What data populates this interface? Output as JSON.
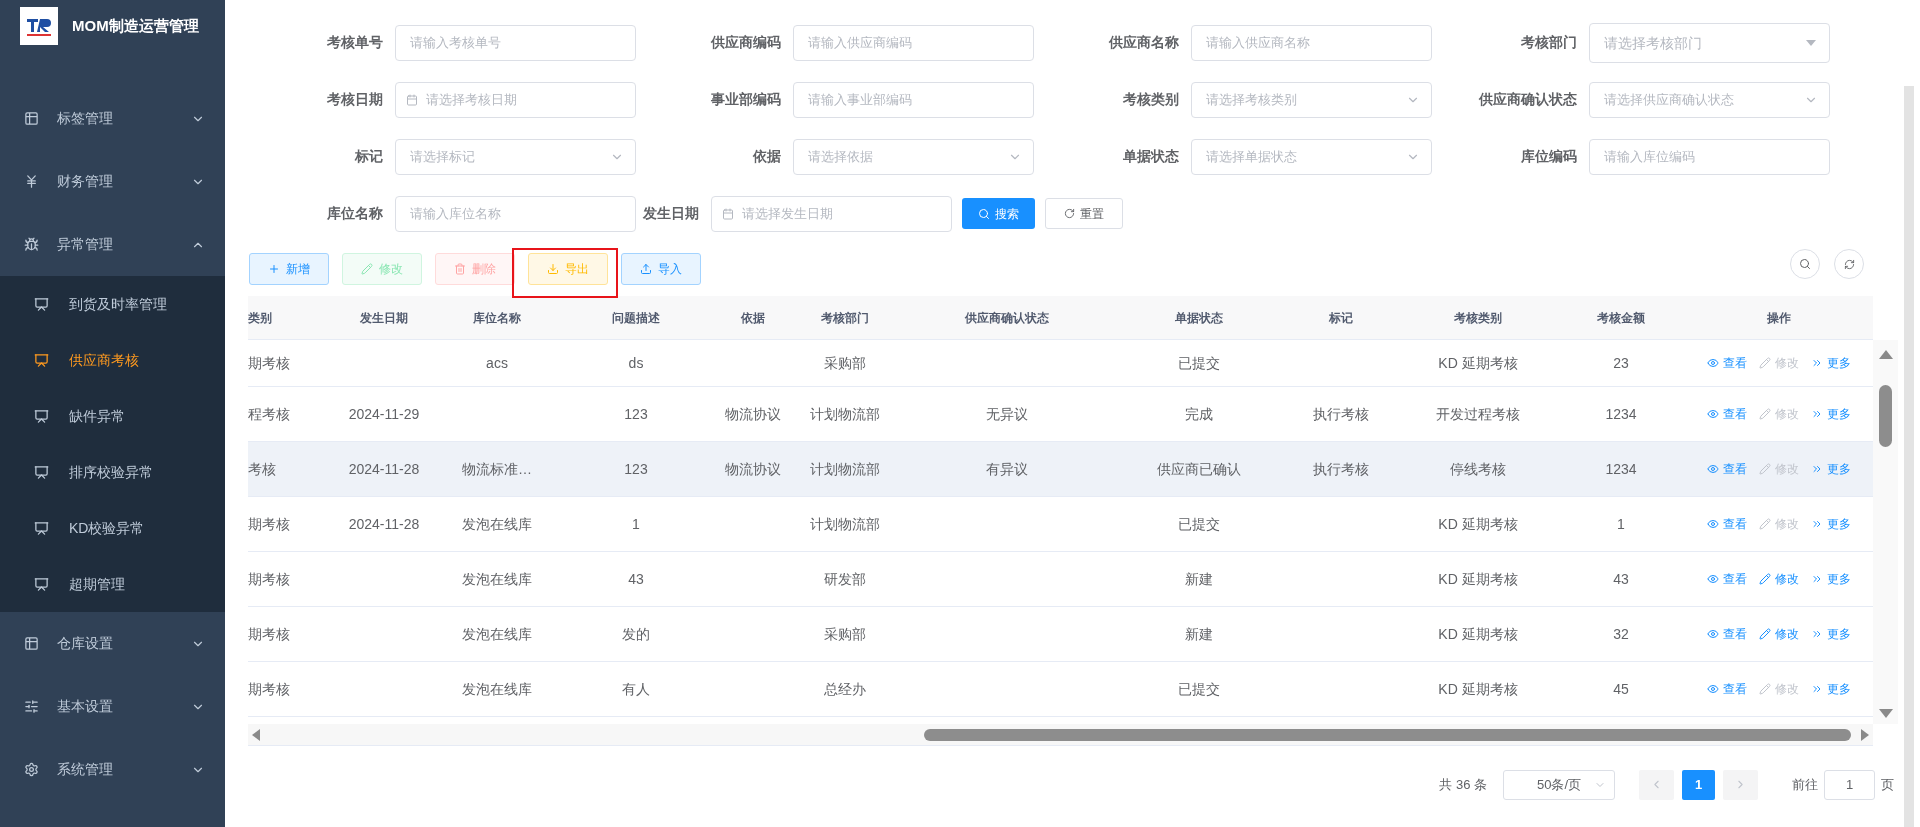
{
  "sidebar": {
    "title": "MOM制造运营管理",
    "items": [
      {
        "label": "标签管理",
        "kind": "grid",
        "expanded": false
      },
      {
        "label": "财务管理",
        "kind": "yen",
        "expanded": false
      },
      {
        "label": "异常管理",
        "kind": "bug",
        "expanded": true,
        "children": [
          {
            "label": "到货及时率管理",
            "selected": false
          },
          {
            "label": "供应商考核",
            "selected": true
          },
          {
            "label": "缺件异常",
            "selected": false
          },
          {
            "label": "排序校验异常",
            "selected": false
          },
          {
            "label": "KD校验异常",
            "selected": false
          },
          {
            "label": "超期管理",
            "selected": false
          }
        ]
      },
      {
        "label": "仓库设置",
        "kind": "grid",
        "expanded": false
      },
      {
        "label": "基本设置",
        "kind": "sliders",
        "expanded": false
      },
      {
        "label": "系统管理",
        "kind": "gear",
        "expanded": false
      }
    ]
  },
  "filters": [
    {
      "label": "考核单号",
      "kind": "text",
      "placeholder": "请输入考核单号"
    },
    {
      "label": "供应商编码",
      "kind": "text",
      "placeholder": "请输入供应商编码"
    },
    {
      "label": "供应商名称",
      "kind": "text",
      "placeholder": "请输入供应商名称"
    },
    {
      "label": "考核部门",
      "kind": "dropdown",
      "placeholder": "请选择考核部门"
    },
    {
      "label": "考核日期",
      "kind": "date",
      "placeholder": "请选择考核日期"
    },
    {
      "label": "事业部编码",
      "kind": "text",
      "placeholder": "请输入事业部编码"
    },
    {
      "label": "考核类别",
      "kind": "select",
      "placeholder": "请选择考核类别"
    },
    {
      "label": "供应商确认状态",
      "kind": "select",
      "placeholder": "请选择供应商确认状态"
    },
    {
      "label": "标记",
      "kind": "select",
      "placeholder": "请选择标记"
    },
    {
      "label": "依据",
      "kind": "select",
      "placeholder": "请选择依据"
    },
    {
      "label": "单据状态",
      "kind": "select",
      "placeholder": "请选择单据状态"
    },
    {
      "label": "库位编码",
      "kind": "text",
      "placeholder": "请输入库位编码"
    },
    {
      "label": "库位名称",
      "kind": "text",
      "placeholder": "请输入库位名称"
    },
    {
      "label": "发生日期",
      "kind": "date",
      "placeholder": "请选择发生日期"
    }
  ],
  "filter_actions": [
    {
      "label": "搜索",
      "kind": "search"
    },
    {
      "label": "重置",
      "kind": "reset"
    }
  ],
  "toolbar": [
    {
      "label": "新增",
      "kind": "add",
      "disabled": false,
      "highlighted": false
    },
    {
      "label": "修改",
      "kind": "edit",
      "disabled": true,
      "highlighted": false
    },
    {
      "label": "删除",
      "kind": "delete",
      "disabled": true,
      "highlighted": false
    },
    {
      "label": "导出",
      "kind": "export",
      "disabled": false,
      "highlighted": true
    },
    {
      "label": "导入",
      "kind": "import",
      "disabled": false,
      "highlighted": false
    }
  ],
  "table": {
    "columns": [
      "类别",
      "发生日期",
      "库位名称",
      "问题描述",
      "依据",
      "考核部门",
      "供应商确认状态",
      "单据状态",
      "标记",
      "考核类别",
      "考核金额",
      "操作"
    ],
    "rows": [
      {
        "highlighted": false,
        "cells": [
          "期考核",
          "",
          "acs",
          "ds",
          "",
          "采购部",
          "",
          "已提交",
          "",
          "KD 延期考核",
          "23"
        ],
        "actions": [
          {
            "label": "查看",
            "kind": "view",
            "disabled": false
          },
          {
            "label": "修改",
            "kind": "edit",
            "disabled": true
          },
          {
            "label": "更多",
            "kind": "more",
            "disabled": false
          }
        ]
      },
      {
        "highlighted": false,
        "cells": [
          "程考核",
          "2024-11-29",
          "",
          "123",
          "物流协议",
          "计划物流部",
          "无异议",
          "完成",
          "执行考核",
          "开发过程考核",
          "1234"
        ],
        "actions": [
          {
            "label": "查看",
            "kind": "view",
            "disabled": false
          },
          {
            "label": "修改",
            "kind": "edit",
            "disabled": true
          },
          {
            "label": "更多",
            "kind": "more",
            "disabled": false
          }
        ]
      },
      {
        "highlighted": true,
        "cells": [
          "考核",
          "2024-11-28",
          "物流标准…",
          "123",
          "物流协议",
          "计划物流部",
          "有异议",
          "供应商已确认",
          "执行考核",
          "停线考核",
          "1234"
        ],
        "actions": [
          {
            "label": "查看",
            "kind": "view",
            "disabled": false
          },
          {
            "label": "修改",
            "kind": "edit",
            "disabled": true
          },
          {
            "label": "更多",
            "kind": "more",
            "disabled": false
          }
        ]
      },
      {
        "highlighted": false,
        "cells": [
          "期考核",
          "2024-11-28",
          "发泡在线库",
          "1",
          "",
          "计划物流部",
          "",
          "已提交",
          "",
          "KD 延期考核",
          "1"
        ],
        "actions": [
          {
            "label": "查看",
            "kind": "view",
            "disabled": false
          },
          {
            "label": "修改",
            "kind": "edit",
            "disabled": true
          },
          {
            "label": "更多",
            "kind": "more",
            "disabled": false
          }
        ]
      },
      {
        "highlighted": false,
        "cells": [
          "期考核",
          "",
          "发泡在线库",
          "43",
          "",
          "研发部",
          "",
          "新建",
          "",
          "KD 延期考核",
          "43"
        ],
        "actions": [
          {
            "label": "查看",
            "kind": "view",
            "disabled": false
          },
          {
            "label": "修改",
            "kind": "edit",
            "disabled": false
          },
          {
            "label": "更多",
            "kind": "more",
            "disabled": false
          }
        ]
      },
      {
        "highlighted": false,
        "cells": [
          "期考核",
          "",
          "发泡在线库",
          "发的",
          "",
          "采购部",
          "",
          "新建",
          "",
          "KD 延期考核",
          "32"
        ],
        "actions": [
          {
            "label": "查看",
            "kind": "view",
            "disabled": false
          },
          {
            "label": "修改",
            "kind": "edit",
            "disabled": false
          },
          {
            "label": "更多",
            "kind": "more",
            "disabled": false
          }
        ]
      },
      {
        "highlighted": false,
        "cells": [
          "期考核",
          "",
          "发泡在线库",
          "有人",
          "",
          "总经办",
          "",
          "已提交",
          "",
          "KD 延期考核",
          "45"
        ],
        "actions": [
          {
            "label": "查看",
            "kind": "view",
            "disabled": false
          },
          {
            "label": "修改",
            "kind": "edit",
            "disabled": true
          },
          {
            "label": "更多",
            "kind": "more",
            "disabled": false
          }
        ]
      }
    ]
  },
  "pagination": {
    "total": "共 36 条",
    "page_size": "50条/页",
    "pages": [
      {
        "label": "1",
        "selected": true
      }
    ],
    "goto_label": "前往",
    "goto_value": "1",
    "goto_suffix": "页"
  }
}
